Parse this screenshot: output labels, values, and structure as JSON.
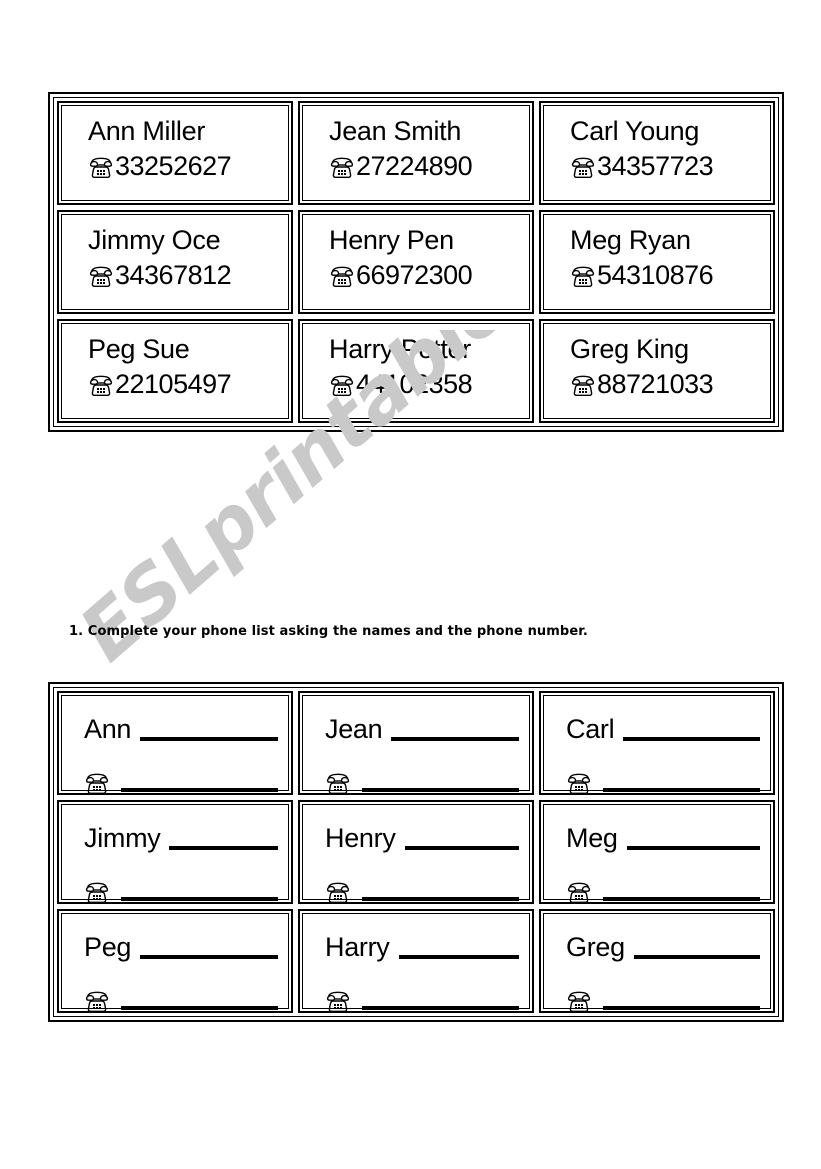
{
  "worksheet": {
    "instruction": "1. Complete your phone list asking the names and the phone number.",
    "watermark": "ESLprintables.com",
    "phone_icon": "telephone-icon",
    "colors": {
      "ink": "#000000",
      "paper": "#ffffff",
      "watermark": "#c9c9c9"
    }
  },
  "contact_cards": {
    "rows": [
      [
        {
          "name": "Ann Miller",
          "phone": "33252627"
        },
        {
          "name": "Jean Smith",
          "phone": "27224890"
        },
        {
          "name": "Carl Young",
          "phone": "34357723"
        }
      ],
      [
        {
          "name": "Jimmy Oce",
          "phone": "34367812"
        },
        {
          "name": "Henry Pen",
          "phone": "66972300"
        },
        {
          "name": "Meg Ryan",
          "phone": "54310876"
        }
      ],
      [
        {
          "name": "Peg Sue",
          "phone": "22105497"
        },
        {
          "name": "Harry Potter",
          "phone": "44102358"
        },
        {
          "name": "Greg King",
          "phone": "88721033"
        }
      ]
    ]
  },
  "blank_cards": {
    "rows": [
      [
        {
          "name": "Ann"
        },
        {
          "name": "Jean"
        },
        {
          "name": "Carl"
        }
      ],
      [
        {
          "name": "Jimmy"
        },
        {
          "name": "Henry"
        },
        {
          "name": "Meg"
        }
      ],
      [
        {
          "name": "Peg"
        },
        {
          "name": "Harry"
        },
        {
          "name": "Greg"
        }
      ]
    ]
  }
}
